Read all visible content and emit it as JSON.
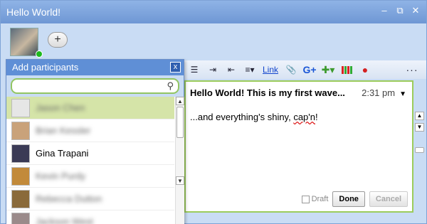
{
  "window": {
    "title": "Hello World!",
    "controls": {
      "minimize": "–",
      "restore": "⧉",
      "close": "✕"
    }
  },
  "participants_bar": {
    "add_button_label": "+"
  },
  "toolbar": {
    "link_label": "Link",
    "more_label": "···"
  },
  "wave": {
    "title": "Hello World! This is my first wave...",
    "time": "2:31 pm",
    "body_before_typo": "...and everything's shiny, ",
    "body_typo": "cap'n",
    "body_after_typo": "!",
    "draft_label": "Draft",
    "done_label": "Done",
    "cancel_label": "Cancel"
  },
  "add_participants": {
    "title": "Add participants",
    "close_label": "x",
    "search_placeholder": "",
    "contacts": [
      {
        "name": "Jason Chen",
        "blurred": true,
        "selected": true,
        "avatar_color": "#e6e6e6"
      },
      {
        "name": "Brian Kessler",
        "blurred": true,
        "selected": false,
        "avatar_color": "#c9a27a"
      },
      {
        "name": "Gina Trapani",
        "blurred": false,
        "selected": false,
        "avatar_color": "#3a3a55"
      },
      {
        "name": "Kevin Purdy",
        "blurred": true,
        "selected": false,
        "avatar_color": "#c28a3a"
      },
      {
        "name": "Rebecca Dutton",
        "blurred": true,
        "selected": false,
        "avatar_color": "#8a6a3a"
      },
      {
        "name": "Jackson West",
        "blurred": true,
        "selected": false,
        "avatar_color": "#9a8a8a"
      }
    ]
  },
  "colors": {
    "titlebar": "#6f97d4",
    "accent_green": "#9ccc5b",
    "selection": "#d5e4a8",
    "link": "#1144cc"
  }
}
